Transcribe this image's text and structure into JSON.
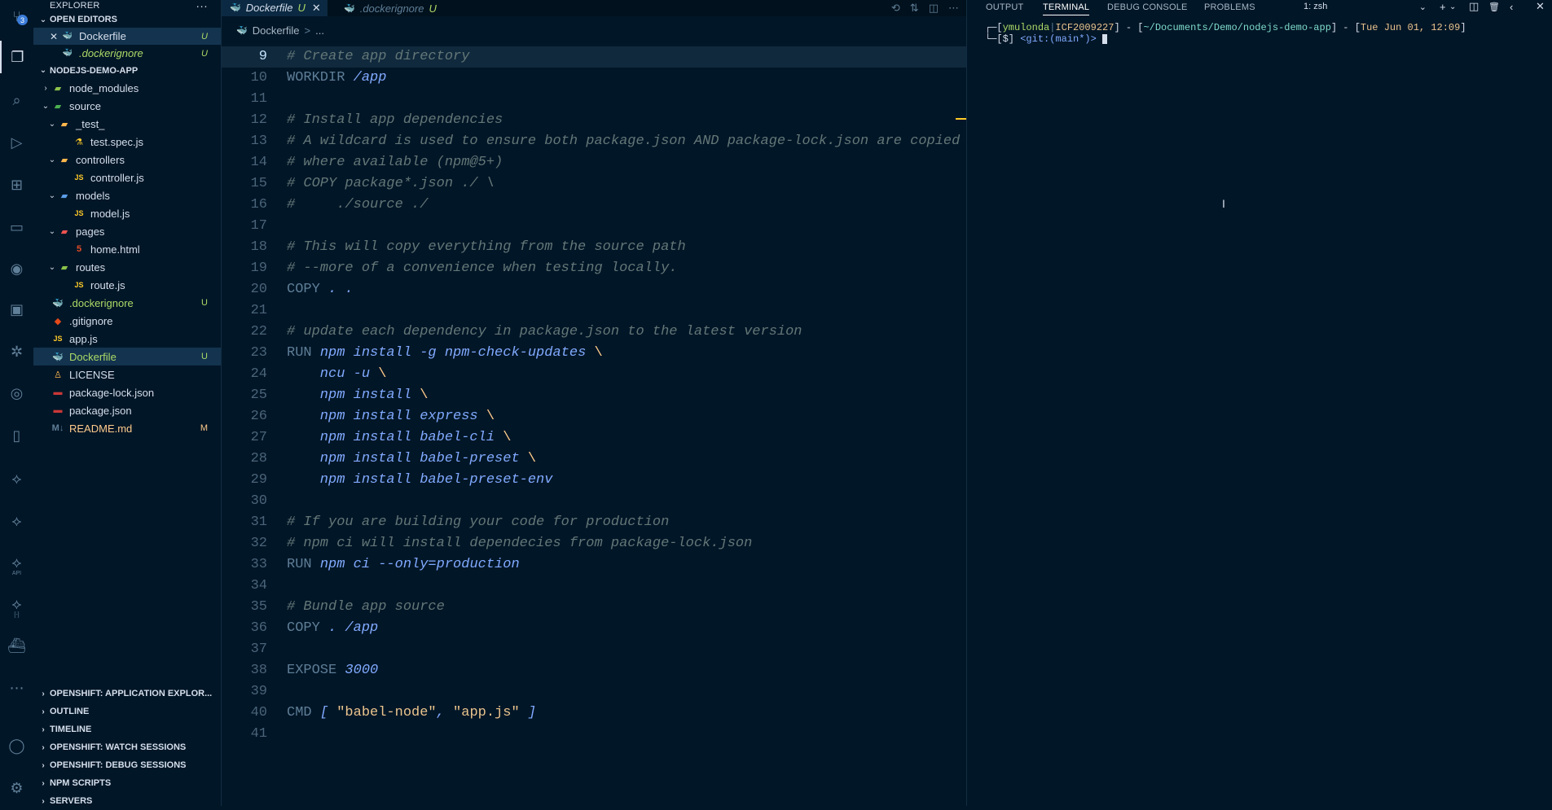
{
  "activity_bar": {
    "items": [
      {
        "icon": "source-control-icon",
        "glyph": "⑂",
        "badge": "3"
      },
      {
        "icon": "explorer-icon",
        "glyph": "❐"
      },
      {
        "icon": "search-icon",
        "glyph": "⌕"
      },
      {
        "icon": "run-debug-icon",
        "glyph": "▷"
      },
      {
        "icon": "extensions-icon",
        "glyph": "⊞"
      },
      {
        "icon": "remote-explorer-icon",
        "glyph": "▭"
      },
      {
        "icon": "gitlens-icon",
        "glyph": "◉"
      },
      {
        "icon": "terminal-icon",
        "glyph": "▣"
      },
      {
        "icon": "kubernetes-icon",
        "glyph": "✲"
      },
      {
        "icon": "openshift-icon",
        "glyph": "◎"
      },
      {
        "icon": "bookmarks-icon",
        "glyph": "▯"
      },
      {
        "icon": "api-connect-icon",
        "glyph": "⟡"
      },
      {
        "icon": "api-test-icon",
        "glyph": "⟡"
      },
      {
        "icon": "api-icon",
        "glyph": "⟡",
        "sub": "API"
      },
      {
        "icon": "api-mock-icon",
        "glyph": "⟡",
        "sub": "[-]"
      },
      {
        "icon": "docker-icon",
        "glyph": "⛴"
      },
      {
        "icon": "more-icon",
        "glyph": "⋯"
      }
    ],
    "bottom": [
      {
        "icon": "account-icon",
        "glyph": "◯"
      },
      {
        "icon": "settings-gear-icon",
        "glyph": "⚙"
      }
    ]
  },
  "sidebar": {
    "title": "EXPLORER",
    "more": "···",
    "open_editors": {
      "title": "OPEN EDITORS",
      "items": [
        {
          "name": "Dockerfile",
          "status": "U",
          "icon": "docker-file-icon"
        },
        {
          "name": ".dockerignore",
          "status": "U",
          "icon": "docker-file-icon"
        }
      ]
    },
    "project": {
      "title": "NODEJS-DEMO-APP",
      "tree": [
        {
          "name": "node_modules",
          "type": "folder",
          "depth": 1,
          "expanded": false,
          "icon": "node-modules-folder-icon",
          "color": "#8bc34a"
        },
        {
          "name": "source",
          "type": "folder",
          "depth": 1,
          "expanded": true,
          "icon": "source-folder-icon",
          "color": "#4caf50"
        },
        {
          "name": "_test_",
          "type": "folder",
          "depth": 2,
          "expanded": true,
          "icon": "test-folder-icon",
          "color": "#ffb74d"
        },
        {
          "name": "test.spec.js",
          "type": "file",
          "depth": 3,
          "icon": "test-file-icon",
          "glyph": "⚗",
          "color": "#ffca28"
        },
        {
          "name": "controllers",
          "type": "folder",
          "depth": 2,
          "expanded": true,
          "icon": "controllers-folder-icon",
          "color": "#ffb74d"
        },
        {
          "name": "controller.js",
          "type": "file",
          "depth": 3,
          "icon": "js-file-icon",
          "glyph": "JS",
          "color": "#ffca28"
        },
        {
          "name": "models",
          "type": "folder",
          "depth": 2,
          "expanded": true,
          "icon": "models-folder-icon",
          "color": "#5c9ee8"
        },
        {
          "name": "model.js",
          "type": "file",
          "depth": 3,
          "icon": "js-file-icon",
          "glyph": "JS",
          "color": "#ffca28"
        },
        {
          "name": "pages",
          "type": "folder",
          "depth": 2,
          "expanded": true,
          "icon": "pages-folder-icon",
          "color": "#ef5350"
        },
        {
          "name": "home.html",
          "type": "file",
          "depth": 3,
          "icon": "html-file-icon",
          "glyph": "5",
          "color": "#e44d26"
        },
        {
          "name": "routes",
          "type": "folder",
          "depth": 2,
          "expanded": true,
          "icon": "routes-folder-icon",
          "color": "#8bc34a"
        },
        {
          "name": "route.js",
          "type": "file",
          "depth": 3,
          "icon": "js-file-icon",
          "glyph": "JS",
          "color": "#ffca28"
        },
        {
          "name": ".dockerignore",
          "type": "file",
          "depth": 1,
          "status": "U",
          "icon": "docker-file-icon",
          "glyph": "🐳",
          "color": "#3b9bd4"
        },
        {
          "name": ".gitignore",
          "type": "file",
          "depth": 1,
          "icon": "git-file-icon",
          "glyph": "◆",
          "color": "#e64a19"
        },
        {
          "name": "app.js",
          "type": "file",
          "depth": 1,
          "icon": "js-file-icon",
          "glyph": "JS",
          "color": "#ffca28"
        },
        {
          "name": "Dockerfile",
          "type": "file",
          "depth": 1,
          "status": "U",
          "icon": "docker-file-icon",
          "glyph": "🐳",
          "color": "#3b9bd4",
          "selected": true
        },
        {
          "name": "LICENSE",
          "type": "file",
          "depth": 1,
          "icon": "license-file-icon",
          "glyph": "♙",
          "color": "#ffb74d"
        },
        {
          "name": "package-lock.json",
          "type": "file",
          "depth": 1,
          "icon": "npm-file-icon",
          "glyph": "▬",
          "color": "#cb3837"
        },
        {
          "name": "package.json",
          "type": "file",
          "depth": 1,
          "icon": "npm-file-icon",
          "glyph": "▬",
          "color": "#cb3837"
        },
        {
          "name": "README.md",
          "type": "file",
          "depth": 1,
          "status": "M",
          "icon": "markdown-file-icon",
          "glyph": "M↓",
          "color": "#5f7e97"
        }
      ]
    },
    "collapsed_sections": [
      "OPENSHIFT: APPLICATION EXPLOR...",
      "OUTLINE",
      "TIMELINE",
      "OPENSHIFT: WATCH SESSIONS",
      "OPENSHIFT: DEBUG SESSIONS",
      "NPM SCRIPTS",
      "SERVERS"
    ]
  },
  "editor": {
    "tabs": [
      {
        "label": "Dockerfile",
        "status": "U",
        "active": true,
        "close": "✕"
      },
      {
        "label": ".dockerignore",
        "status": "U",
        "active": false
      }
    ],
    "actions": [
      "⟲",
      "⇅",
      "◫",
      "⋯"
    ],
    "breadcrumb": {
      "file": "Dockerfile",
      "sep": ">",
      "rest": "..."
    },
    "lines": [
      {
        "n": "9",
        "current": true,
        "t": [
          [
            "cm",
            "# Create app directory"
          ]
        ]
      },
      {
        "n": "10",
        "t": [
          [
            "kw",
            "WORKDIR "
          ],
          [
            "sy",
            "/app"
          ]
        ]
      },
      {
        "n": "11",
        "t": []
      },
      {
        "n": "12",
        "t": [
          [
            "cm",
            "# Install app dependencies"
          ]
        ]
      },
      {
        "n": "13",
        "t": [
          [
            "cm",
            "# A wildcard is used to ensure both package.json AND package-lock.json are copied"
          ]
        ]
      },
      {
        "n": "14",
        "t": [
          [
            "cm",
            "# where available (npm@5+)"
          ]
        ]
      },
      {
        "n": "15",
        "t": [
          [
            "cm",
            "# COPY package*.json ./ \\"
          ]
        ]
      },
      {
        "n": "16",
        "t": [
          [
            "cm",
            "#     ./source ./"
          ]
        ]
      },
      {
        "n": "17",
        "t": []
      },
      {
        "n": "18",
        "t": [
          [
            "cm",
            "# This will copy everything from the source path"
          ]
        ]
      },
      {
        "n": "19",
        "t": [
          [
            "cm",
            "# --more of a convenience when testing locally."
          ]
        ]
      },
      {
        "n": "20",
        "t": [
          [
            "kw",
            "COPY "
          ],
          [
            "sy",
            ". ."
          ]
        ]
      },
      {
        "n": "21",
        "t": []
      },
      {
        "n": "22",
        "t": [
          [
            "cm",
            "# update each dependency in package.json to the latest version"
          ]
        ]
      },
      {
        "n": "23",
        "t": [
          [
            "kw",
            "RUN "
          ],
          [
            "sy",
            "npm install -g npm-check-updates "
          ],
          [
            "pu",
            "\\"
          ]
        ]
      },
      {
        "n": "24",
        "t": [
          [
            "sy",
            "    ncu -u "
          ],
          [
            "pu",
            "\\"
          ]
        ]
      },
      {
        "n": "25",
        "t": [
          [
            "sy",
            "    npm install "
          ],
          [
            "pu",
            "\\"
          ]
        ]
      },
      {
        "n": "26",
        "t": [
          [
            "sy",
            "    npm install express "
          ],
          [
            "pu",
            "\\"
          ]
        ]
      },
      {
        "n": "27",
        "t": [
          [
            "sy",
            "    npm install babel-cli "
          ],
          [
            "pu",
            "\\"
          ]
        ]
      },
      {
        "n": "28",
        "t": [
          [
            "sy",
            "    npm install babel-preset "
          ],
          [
            "pu",
            "\\"
          ]
        ]
      },
      {
        "n": "29",
        "t": [
          [
            "sy",
            "    npm install babel-preset-env"
          ]
        ]
      },
      {
        "n": "30",
        "t": []
      },
      {
        "n": "31",
        "t": [
          [
            "cm",
            "# If you are building your code for production"
          ]
        ]
      },
      {
        "n": "32",
        "t": [
          [
            "cm",
            "# npm ci will install dependecies from package-lock.json"
          ]
        ]
      },
      {
        "n": "33",
        "t": [
          [
            "kw",
            "RUN "
          ],
          [
            "sy",
            "npm ci --only=production"
          ]
        ]
      },
      {
        "n": "34",
        "t": []
      },
      {
        "n": "35",
        "t": [
          [
            "cm",
            "# Bundle app source"
          ]
        ]
      },
      {
        "n": "36",
        "t": [
          [
            "kw",
            "COPY "
          ],
          [
            "sy",
            ". /app"
          ]
        ]
      },
      {
        "n": "37",
        "t": []
      },
      {
        "n": "38",
        "t": [
          [
            "kw",
            "EXPOSE "
          ],
          [
            "sy",
            "3000"
          ]
        ]
      },
      {
        "n": "39",
        "t": []
      },
      {
        "n": "40",
        "t": [
          [
            "kw",
            "CMD "
          ],
          [
            "sy",
            "[ "
          ],
          [
            "str",
            "\"babel-node\""
          ],
          [
            "sy",
            ", "
          ],
          [
            "str",
            "\"app.js\""
          ],
          [
            "sy",
            " ]"
          ]
        ]
      },
      {
        "n": "41",
        "t": []
      }
    ]
  },
  "panel": {
    "tabs": [
      "OUTPUT",
      "TERMINAL",
      "DEBUG CONSOLE",
      "PROBLEMS"
    ],
    "active_tab": "TERMINAL",
    "terminal_select": "1: zsh",
    "actions": [
      "+",
      "⌄",
      "◫",
      "🗑",
      "‹",
      "✕"
    ],
    "terminal": {
      "line1": {
        "a": "┌─[",
        "user": "ymulonda",
        "host": "ICF2009227",
        "b": "] - [",
        "path": "~/Documents/Demo/nodejs-demo-app",
        "c": "] - [",
        "date": "Tue Jun 01, 12:09",
        "d": "]"
      },
      "line2": {
        "a": "└─[$] ",
        "git": "<git:(main*)>"
      }
    }
  }
}
